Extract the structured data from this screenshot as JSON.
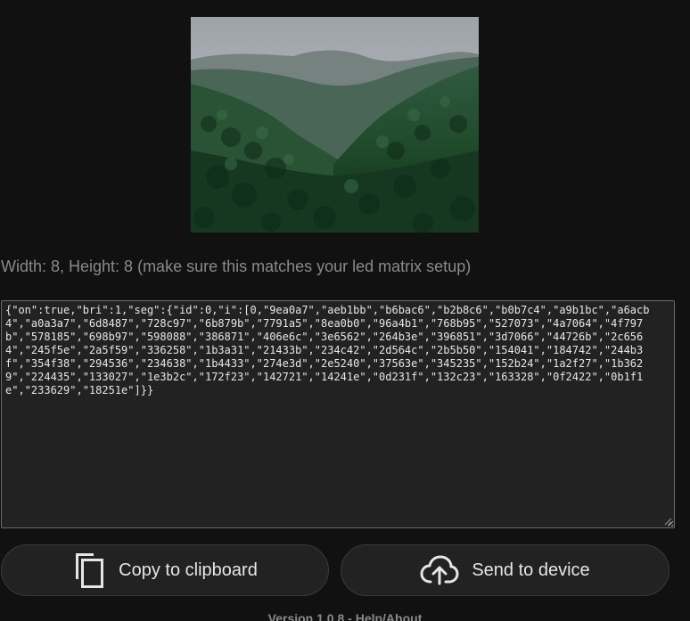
{
  "image": {
    "icon": "forest-valley-photo",
    "colors": {
      "sky": "#b9bcc0",
      "mountain_far": "#6d7a78",
      "mountain_mid": "#3f5a50",
      "forest": "#1f4a2a",
      "forest_dark": "#0f2a16"
    }
  },
  "info": {
    "text": "Width: 8, Height: 8 (make sure this matches your led matrix setup)"
  },
  "output": {
    "json": "{\"on\":true,\"bri\":1,\"seg\":{\"id\":0,\"i\":[0,\"9ea0a7\",\"aeb1bb\",\"b6bac6\",\"b2b8c6\",\"b0b7c4\",\"a9b1bc\",\"a6acb4\",\"a0a3a7\",\"6d8487\",\"728c97\",\"6b879b\",\"7791a5\",\"8ea0b0\",\"96a4b1\",\"768b95\",\"527073\",\"4a7064\",\"4f797b\",\"578185\",\"698b97\",\"598088\",\"386871\",\"406e6c\",\"3e6562\",\"264b3e\",\"396851\",\"3d7066\",\"44726b\",\"2c6564\",\"245f5e\",\"2a5f59\",\"336258\",\"1b3a31\",\"21433b\",\"234c42\",\"2d564c\",\"2b5b50\",\"154041\",\"184742\",\"244b3f\",\"354f38\",\"294536\",\"234638\",\"1b4433\",\"274e3d\",\"2e5240\",\"37563e\",\"345235\",\"152b24\",\"1a2f27\",\"1b3629\",\"224435\",\"133027\",\"1e3b2c\",\"172f23\",\"142721\",\"14241e\",\"0d231f\",\"132c23\",\"163328\",\"0f2422\",\"0b1f1e\",\"233629\",\"18251e\"]}}"
  },
  "buttons": {
    "copy_label": "Copy to clipboard",
    "copy_icon": "copy-icon",
    "send_label": "Send to device",
    "send_icon": "cloud-upload-icon"
  },
  "footer": {
    "version": "Version 1.0.8",
    "separator": " - ",
    "help": "Help/About"
  }
}
